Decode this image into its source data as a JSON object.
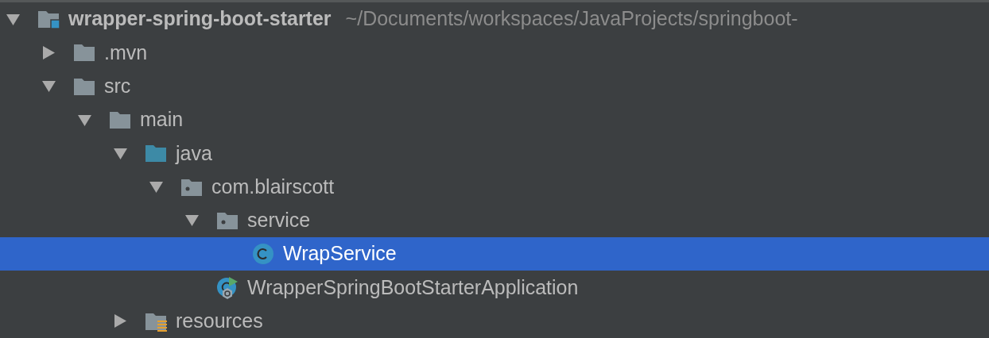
{
  "tree": [
    {
      "label": "wrapper-spring-boot-starter",
      "path": "~/Documents/workspaces/JavaProjects/springboot-",
      "kind": "module",
      "expanded": true,
      "selected": false,
      "children": [
        {
          "label": ".mvn",
          "kind": "folder",
          "expanded": false,
          "selected": false
        },
        {
          "label": "src",
          "kind": "folder",
          "expanded": true,
          "selected": false,
          "children": [
            {
              "label": "main",
              "kind": "folder",
              "expanded": true,
              "selected": false,
              "children": [
                {
                  "label": "java",
                  "kind": "source-folder",
                  "expanded": true,
                  "selected": false,
                  "children": [
                    {
                      "label": "com.blairscott",
                      "kind": "package",
                      "expanded": true,
                      "selected": false,
                      "children": [
                        {
                          "label": "service",
                          "kind": "package",
                          "expanded": true,
                          "selected": false,
                          "children": [
                            {
                              "label": "WrapService",
                              "kind": "class",
                              "selected": true
                            }
                          ]
                        },
                        {
                          "label": "WrapperSpringBootStarterApplication",
                          "kind": "spring-app",
                          "selected": false
                        }
                      ]
                    }
                  ]
                },
                {
                  "label": "resources",
                  "kind": "resources-folder",
                  "expanded": false,
                  "selected": false
                }
              ]
            }
          ]
        }
      ]
    }
  ]
}
